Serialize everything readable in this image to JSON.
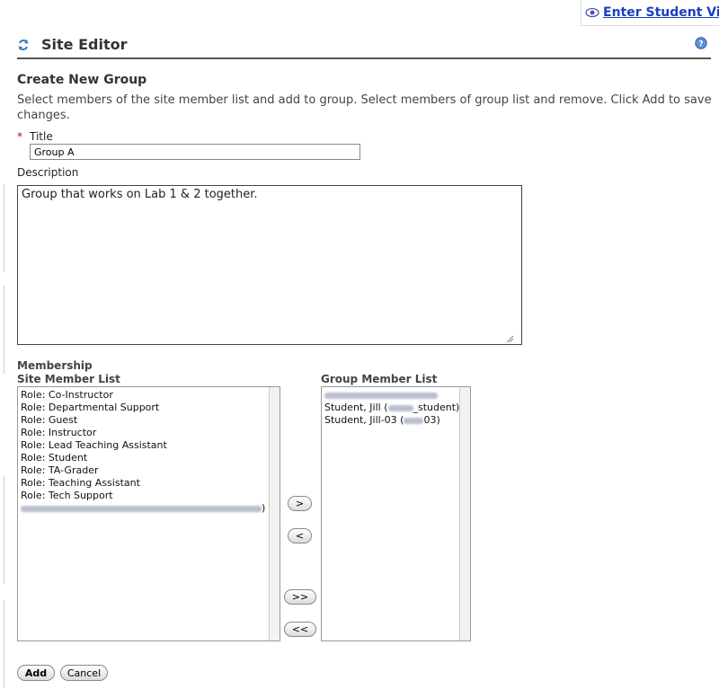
{
  "student_view": {
    "label": "Enter Student View",
    "icon": "eye-icon"
  },
  "header": {
    "title": "Site Editor",
    "icon": "refresh-icon",
    "help_icon": "help-icon"
  },
  "form": {
    "section_title": "Create New Group",
    "instructions": "Select members of the site member list and add to group. Select members of group list and remove. Click Add to save changes.",
    "required_marker": "*",
    "title_label": "Title",
    "title_value": "Group A",
    "description_label": "Description",
    "description_value": "Group that works on Lab 1 & 2 together.",
    "membership_label": "Membership",
    "site_member_list_label": "Site Member List",
    "group_member_list_label": "Group Member List"
  },
  "site_members": [
    "Role: Co-Instructor",
    "Role: Departmental Support",
    "Role: Guest",
    "Role: Instructor",
    "Role: Lead Teaching Assistant",
    "Role: Student",
    "Role: TA-Grader",
    "Role: Teaching Assistant",
    "Role: Tech Support"
  ],
  "site_members_blurred_suffix": ")",
  "group_members": {
    "item2_prefix": "Student, Jill (",
    "item2_suffix": "_student)",
    "item3_prefix": "Student, Jill-03 (",
    "item3_suffix": "03)"
  },
  "buttons": {
    "add_one": ">",
    "remove_one": "<",
    "add_all": ">>",
    "remove_all": "<<",
    "add": "Add",
    "cancel": "Cancel"
  }
}
